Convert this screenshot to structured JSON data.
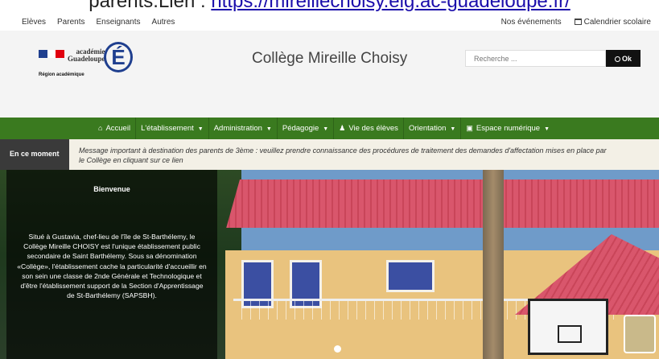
{
  "caption": {
    "prefix": "parents.Lien : ",
    "link": "https://mireillechoisy.elg.ac-guadeloupe.fr/"
  },
  "topbar": {
    "left_links": [
      "Elèves",
      "Parents",
      "Enseignants",
      "Autres"
    ],
    "events": "Nos événements",
    "calendar": "Calendrier scolaire"
  },
  "header": {
    "logo": {
      "line1": "académie",
      "line2": "Guadeloupe",
      "region": "Région académique",
      "letter": "É"
    },
    "title": "Collège Mireille Choisy",
    "search_placeholder": "Recherche ...",
    "search_button": "Ok"
  },
  "nav": [
    {
      "label": "Accueil",
      "icon": "home-icon"
    },
    {
      "label": "L'établissement",
      "caret": true
    },
    {
      "label": "Administration",
      "caret": true
    },
    {
      "label": "Pédagogie",
      "caret": true
    },
    {
      "label": "Vie des élèves",
      "icon": "user-icon"
    },
    {
      "label": "Orientation",
      "caret": true
    },
    {
      "label": "Espace numérique",
      "icon": "screen-icon",
      "caret": true
    }
  ],
  "news": {
    "label": "En ce moment",
    "line1": "Message important à destination des parents de 3ème : veuillez prendre connaissance des procédures de traitement des demandes d'affectation mises en place par",
    "line2": "le Collège en cliquant sur ce lien"
  },
  "welcome": {
    "title": "Bienvenue",
    "text": "Situé à Gustavia, chef-lieu de l'île de St-Barthélemy, le Collège Mireille CHOISY est l'unique établissement public secondaire de Saint Barthélemy. Sous sa dénomination «Collège», l'établissement cache la particularité d'accueillir en son sein une classe de 2nde Générale et Technologique et d'être l'établissement support de la Section d'Apprentissage de St-Barthélemy (SAPSBH)."
  },
  "colors": {
    "nav_green": "#3a7a1f",
    "brand_blue": "#1f3f8f"
  }
}
